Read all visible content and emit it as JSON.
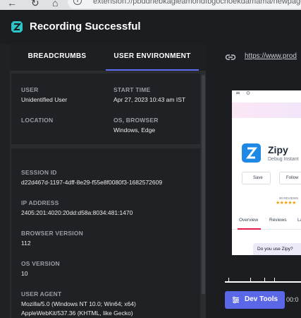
{
  "browser": {
    "url": "extension://pbddhebkagleamondfbgochoekdamama/newpage.html",
    "back_icon": "arrow-left-icon",
    "reload_icon": "reload-icon",
    "home_icon": "home-icon",
    "info_icon": "info-icon",
    "info_glyph": "i"
  },
  "header": {
    "title": "Recording Successful",
    "logo_icon": "zipy-logo-icon",
    "logo_color": "#2ec5c9"
  },
  "tabs": [
    {
      "label": "BREADCRUMBS",
      "active": false
    },
    {
      "label": "USER ENVIRONMENT",
      "active": true
    }
  ],
  "accent_color": "#5c6cf0",
  "user_env": {
    "user_label": "USER",
    "user_value": "Unidentified User",
    "start_label": "START TIME",
    "start_value": "Apr 27, 2023 10:43 am IST",
    "location_label": "LOCATION",
    "location_value": "",
    "os_label": "OS, BROWSER",
    "os_value": "Windows, Edge"
  },
  "session": {
    "session_label": "SESSION ID",
    "session_value": "d22d467d-1197-4dff-8e29-f55e8f0080f3-1682572609",
    "ip_label": "IP ADDRESS",
    "ip_value": "2405:201:4020:20dd:d58a:8034:481:1470",
    "browser_version_label": "BROWSER VERSION",
    "browser_version_value": "112",
    "os_version_label": "OS VERSION",
    "os_version_value": "10",
    "user_agent_label": "USER AGENT",
    "user_agent_line1": "Mozilla/5.0 (Windows NT 10.0; Win64; x64)",
    "user_agent_line2": "AppleWebKit/537.36 (KHTML, like Gecko)"
  },
  "player": {
    "link_icon": "link-icon",
    "page_url": "https://www.prod",
    "preview": {
      "app_name": "Zipy",
      "app_sub": "Debug Instant",
      "save_label": "Save",
      "follow_label": "Follow",
      "reviews_text": "90 REVIEWS",
      "stars": "★★★★★",
      "tab_overview": "Overview",
      "tab_reviews": "Reviews",
      "tab_la": "La",
      "question": "Do you use Zipy?"
    },
    "devtools_label": "Dev Tools",
    "devtools_icon": "sliders-icon",
    "time": "00:0"
  }
}
